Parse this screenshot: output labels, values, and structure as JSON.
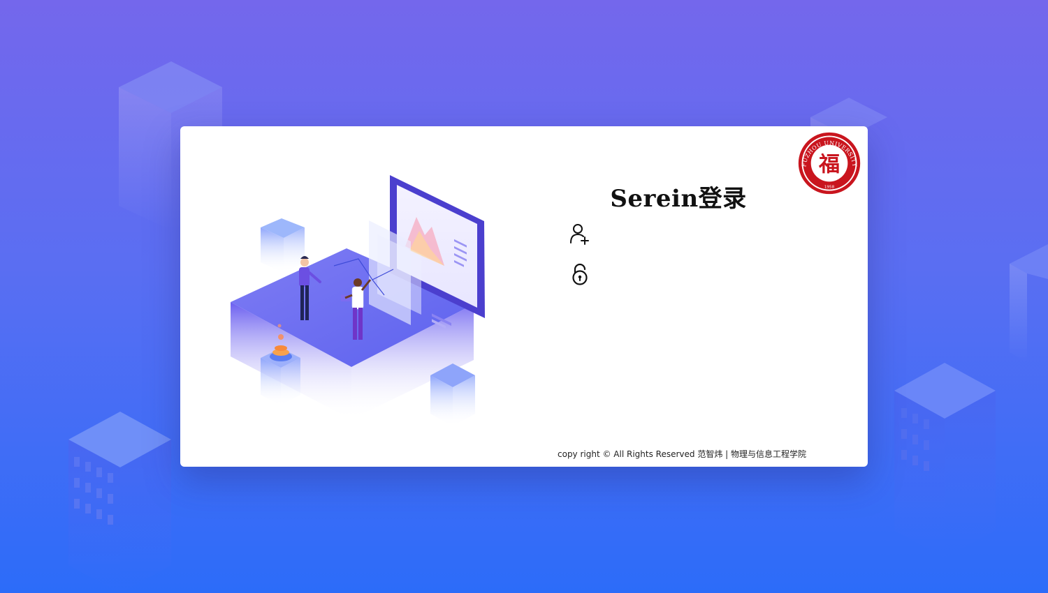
{
  "login": {
    "title": "Serein登录",
    "username": {
      "icon": "add-user-icon",
      "value": "",
      "placeholder": ""
    },
    "password": {
      "icon": "lock-icon",
      "value": "",
      "placeholder": ""
    }
  },
  "logo": {
    "icon": "university-seal-logo",
    "text": "FUZHOU UNIVERSITY",
    "glyph": "福",
    "year": "1958"
  },
  "footer": {
    "copyright": "copy right © All Rights Reserved 范智炜 | 物理与信息工程学院"
  },
  "colors": {
    "bg_top": "#7467ec",
    "bg_bottom": "#2c6cf9",
    "seal_red": "#c9151e",
    "illustration_purple": "#5b4ce0"
  }
}
